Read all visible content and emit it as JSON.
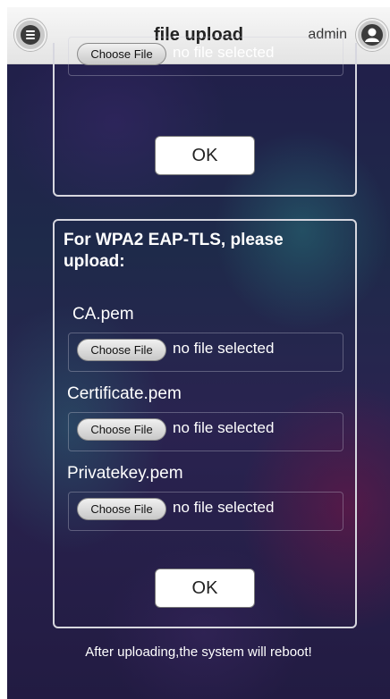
{
  "header": {
    "title": "file upload",
    "username": "admin"
  },
  "top_card": {
    "file_row": {
      "button_label": "Choose File",
      "status": "no file selected"
    },
    "ok_label": "OK"
  },
  "eap_tls_card": {
    "heading": "For WPA2 EAP-TLS, please upload:",
    "files": [
      {
        "label": "CA.pem",
        "button_label": "Choose File",
        "status": "no file selected"
      },
      {
        "label": "Certificate.pem",
        "button_label": "Choose File",
        "status": "no file selected"
      },
      {
        "label": "Privatekey.pem",
        "button_label": "Choose File",
        "status": "no file selected"
      }
    ],
    "ok_label": "OK"
  },
  "footer_note": "After uploading,the system will reboot!",
  "colors": {
    "header_bg": "#eeeeee",
    "text_light": "#ffffff",
    "card_border": "#d7d7df"
  }
}
